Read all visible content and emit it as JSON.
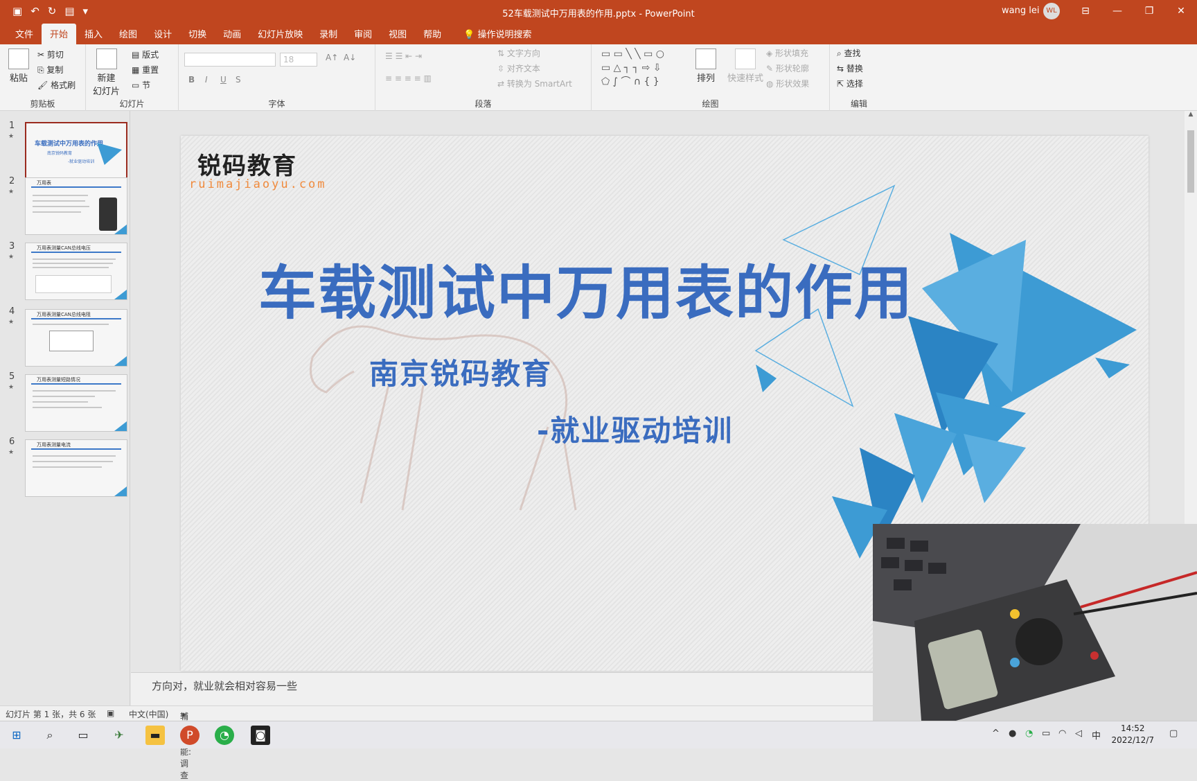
{
  "window": {
    "title": "52车载测试中万用表的作用.pptx  -  PowerPoint",
    "user": "wang lei",
    "avatar_initials": "WL"
  },
  "ribbon": {
    "tabs": [
      "文件",
      "开始",
      "插入",
      "绘图",
      "设计",
      "切换",
      "动画",
      "幻灯片放映",
      "录制",
      "审阅",
      "视图",
      "帮助"
    ],
    "active_tab": "开始",
    "tell_me": "操作说明搜索",
    "clipboard": {
      "paste": "粘贴",
      "cut": "剪切",
      "copy": "复制",
      "format_painter": "格式刷",
      "label": "剪贴板"
    },
    "slides": {
      "new_slide": "新建\n幻灯片",
      "layout": "版式",
      "reset": "重置",
      "section": "节",
      "label": "幻灯片"
    },
    "font": {
      "name_value": "",
      "size_value": "18",
      "label": "字体"
    },
    "paragraph": {
      "text_direction": "文字方向",
      "align_text": "对齐文本",
      "convert_smartart": "转换为 SmartArt",
      "label": "段落"
    },
    "drawing": {
      "arrange": "排列",
      "quick_styles": "快速样式",
      "shape_fill": "形状填充",
      "shape_outline": "形状轮廓",
      "shape_effects": "形状效果",
      "label": "绘图"
    },
    "editing": {
      "find": "查找",
      "replace": "替换",
      "select": "选择",
      "label": "编辑"
    }
  },
  "thumbnails": [
    {
      "num": "1",
      "title": "车载测试中万用表的作用",
      "sub1": "南京锐码教育",
      "sub2": "-就业驱动培训"
    },
    {
      "num": "2",
      "title": "万用表"
    },
    {
      "num": "3",
      "title": "万用表测量CAN总线电压"
    },
    {
      "num": "4",
      "title": "万用表测量CAN总线电阻"
    },
    {
      "num": "5",
      "title": "万用表测量短路情况"
    },
    {
      "num": "6",
      "title": "万用表测量电流"
    }
  ],
  "slide": {
    "logo_text": "锐码教育",
    "logo_url": "ruimajiaoyu.com",
    "title": "车载测试中万用表的作用",
    "subtitle1": "南京锐码教育",
    "subtitle2": "-就业驱动培训"
  },
  "notes": "方向对，就业就会相对容易一些",
  "status": {
    "slide_count": "幻灯片 第 1 张，共 6 张",
    "language": "中文(中国)",
    "accessibility": "辅助功能: 调查"
  },
  "taskbar": {
    "time": "14:52",
    "date": "2022/12/7",
    "ime": "中"
  },
  "colors": {
    "accent": "#c0461f",
    "title_blue": "#3a6cbf",
    "logo_orange": "#f08a3c"
  }
}
